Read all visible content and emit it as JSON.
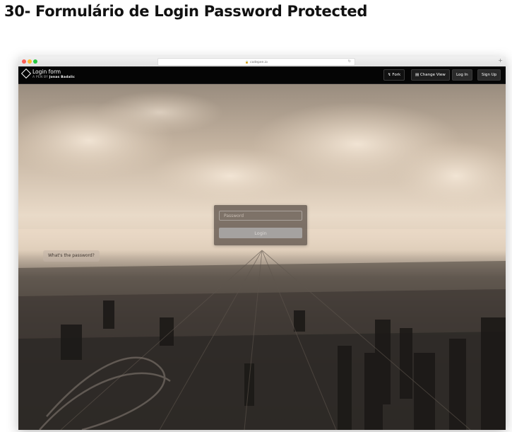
{
  "page_title": "30- Formulário de Login Password Protected",
  "browser": {
    "url": "codepen.io"
  },
  "codepen": {
    "pen_title": "Login form",
    "by_prefix": "A PEN BY",
    "author": "Jonas Badalic",
    "buttons": {
      "fork": "Fork",
      "change_view": "Change View",
      "log_in": "Log In",
      "sign_up": "Sign Up"
    }
  },
  "login": {
    "password_placeholder": "Password",
    "submit_label": "Login"
  },
  "hint": {
    "label": "What's the password?"
  },
  "icons": {
    "fork": "fork-icon",
    "change_view": "layout-icon",
    "lock": "lock-icon",
    "reload": "reload-icon",
    "logo": "codepen-logo-icon"
  },
  "colors": {
    "header_bg": "#050505",
    "sky": "#e9dac8",
    "city": "#2e2a27",
    "panel": "#3c322d"
  }
}
